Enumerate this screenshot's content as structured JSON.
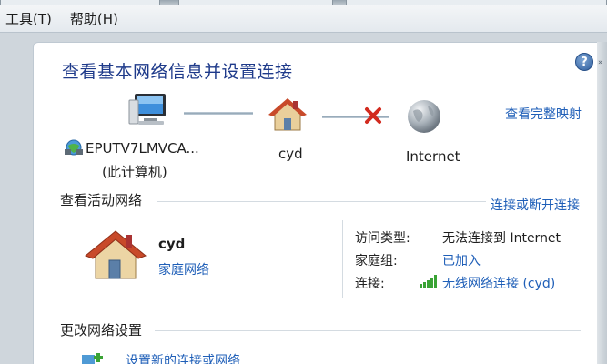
{
  "menubar": {
    "items": [
      {
        "label": "工具(T)"
      },
      {
        "label": "帮助(H)"
      }
    ]
  },
  "help_symbol": "?",
  "page_title": "查看基本网络信息并设置连接",
  "network_map": {
    "see_full_map_link": "查看完整映射",
    "computer": {
      "name": "EPUTV7LMVCA...",
      "subtitle": "(此计算机)"
    },
    "router": {
      "name": "cyd"
    },
    "internet": {
      "name": "Internet"
    },
    "status_icons": [
      "computer-icon",
      "house-icon",
      "red-x-icon",
      "globe-icon"
    ]
  },
  "active_networks": {
    "section_title": "查看活动网络",
    "connect_link": "连接或断开连接",
    "network": {
      "name": "cyd",
      "type_link": "家庭网络",
      "access_type_label": "访问类型:",
      "access_type_value": "无法连接到 Internet",
      "homegroup_label": "家庭组:",
      "homegroup_value": "已加入",
      "connection_label": "连接:",
      "connection_value": "无线网络连接 (cyd)"
    }
  },
  "change_settings": {
    "section_title": "更改网络设置",
    "first_item": "设置新的连接或网络"
  },
  "colors": {
    "link": "#1f5fb8",
    "title": "#1e3a8a",
    "error_x": "#d22a1e",
    "signal_green": "#3aa335"
  }
}
